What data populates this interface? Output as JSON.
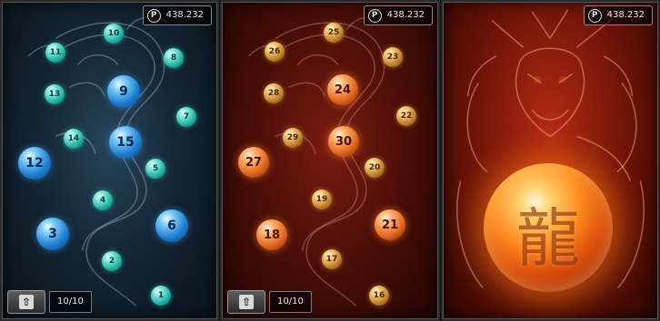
{
  "score_text": "438.232",
  "score_icon_letter": "P",
  "icons": {
    "score": "points-coin-icon",
    "up": "up-arrow-icon"
  },
  "colors": {
    "teal": "#22b3a6",
    "blue": "#1f7fd0",
    "amber": "#c4822b",
    "orange": "#e2661c"
  },
  "panel_blue": {
    "counter": "10/10",
    "up_label": "⇧",
    "orbs": [
      {
        "n": "1",
        "kind": "teal"
      },
      {
        "n": "2",
        "kind": "teal"
      },
      {
        "n": "3",
        "kind": "blue"
      },
      {
        "n": "4",
        "kind": "teal"
      },
      {
        "n": "5",
        "kind": "teal"
      },
      {
        "n": "6",
        "kind": "blue"
      },
      {
        "n": "7",
        "kind": "teal"
      },
      {
        "n": "8",
        "kind": "teal"
      },
      {
        "n": "9",
        "kind": "blue"
      },
      {
        "n": "10",
        "kind": "teal"
      },
      {
        "n": "11",
        "kind": "teal"
      },
      {
        "n": "12",
        "kind": "blue"
      },
      {
        "n": "13",
        "kind": "teal"
      },
      {
        "n": "14",
        "kind": "teal"
      },
      {
        "n": "15",
        "kind": "blue"
      }
    ]
  },
  "panel_orange": {
    "counter": "10/10",
    "up_label": "⇧",
    "orbs": [
      {
        "n": "16",
        "kind": "amber"
      },
      {
        "n": "17",
        "kind": "amber"
      },
      {
        "n": "18",
        "kind": "orange"
      },
      {
        "n": "19",
        "kind": "amber"
      },
      {
        "n": "20",
        "kind": "amber"
      },
      {
        "n": "21",
        "kind": "orange"
      },
      {
        "n": "22",
        "kind": "amber"
      },
      {
        "n": "23",
        "kind": "amber"
      },
      {
        "n": "24",
        "kind": "orange"
      },
      {
        "n": "25",
        "kind": "amber"
      },
      {
        "n": "26",
        "kind": "amber"
      },
      {
        "n": "27",
        "kind": "orange"
      },
      {
        "n": "28",
        "kind": "amber"
      },
      {
        "n": "29",
        "kind": "amber"
      },
      {
        "n": "30",
        "kind": "orange"
      }
    ]
  },
  "panel_dragon": {
    "orb_glyph": "龍"
  }
}
